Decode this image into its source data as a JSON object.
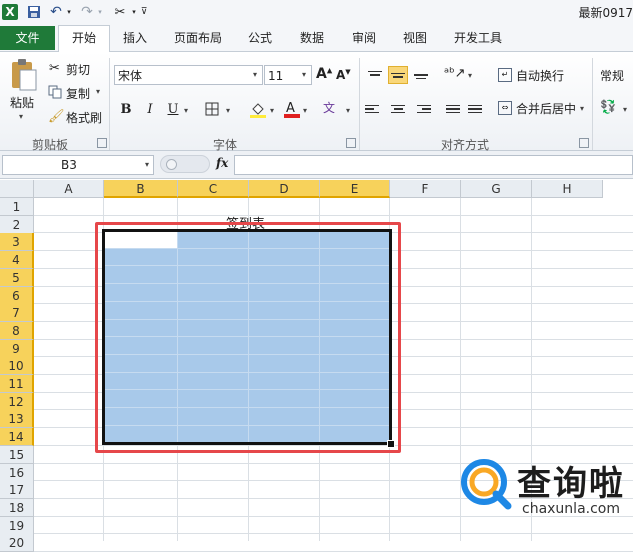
{
  "window": {
    "title": "最新0917"
  },
  "tabs": [
    "文件",
    "开始",
    "插入",
    "页面布局",
    "公式",
    "数据",
    "审阅",
    "视图",
    "开发工具"
  ],
  "clipboard": {
    "paste_label": "粘贴",
    "cut_label": "剪切",
    "copy_label": "复制",
    "format_painter_label": "格式刷",
    "group_label": "剪贴板"
  },
  "font": {
    "name": "宋体",
    "size": "11",
    "bold": "B",
    "italic": "I",
    "underline": "U",
    "group_label": "字体"
  },
  "alignment": {
    "wrap_text_label": "自动换行",
    "merge_center_label": "合并后居中",
    "group_label": "对齐方式"
  },
  "number": {
    "format_value": "常规"
  },
  "formula_bar": {
    "name_box": "B3",
    "fx_label": "fx",
    "formula": ""
  },
  "columns": [
    "A",
    "B",
    "C",
    "D",
    "E",
    "F",
    "G",
    "H"
  ],
  "rows": [
    "1",
    "2",
    "3",
    "4",
    "5",
    "6",
    "7",
    "8",
    "9",
    "10",
    "11",
    "12",
    "13",
    "14",
    "15",
    "16",
    "17",
    "18",
    "19",
    "20"
  ],
  "sheet": {
    "title_text": "签到表"
  },
  "watermark": {
    "brand": "查询啦",
    "url": "chaxunla.com"
  },
  "colors": {
    "excel_green": "#1f7a39",
    "selection_fill": "#a8c9ea",
    "header_highlight": "#f7d25b",
    "red_highlight": "#e6474a"
  }
}
